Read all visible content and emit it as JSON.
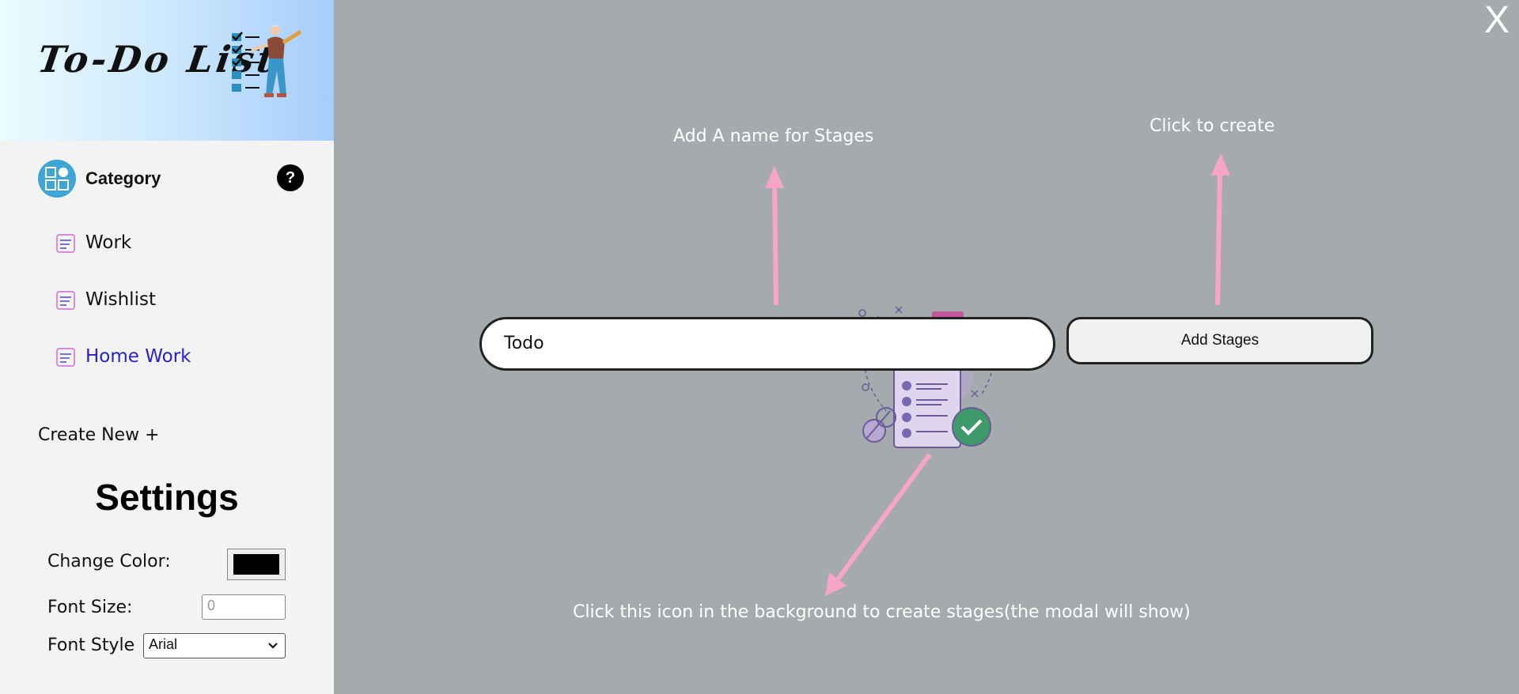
{
  "app": {
    "logo_text": "To-Do List"
  },
  "sidebar": {
    "category_label": "Category",
    "help_label": "?",
    "items": [
      {
        "label": "Work"
      },
      {
        "label": "Wishlist"
      },
      {
        "label": "Home Work"
      }
    ],
    "active_item": "Home Work",
    "create_new_label": "Create New +"
  },
  "settings": {
    "title": "Settings",
    "change_color_label": "Change Color:",
    "color_value": "#000000",
    "font_size_label": "Font Size:",
    "font_size_placeholder": "0",
    "font_style_label": "Font Style",
    "font_style_value": "Arial"
  },
  "modal": {
    "close_label": "X",
    "stage_input_value": "Todo",
    "add_stages_label": "Add Stages",
    "hint_name": "Add A name for Stages",
    "hint_create": "Click to create",
    "hint_icon": "Click this icon in the background to create stages(the modal will show)"
  },
  "colors": {
    "overlay": "#a5aaad",
    "arrow": "#f7a5c5",
    "active_link": "#2a1fc7",
    "category_icon": "#3fa5d3"
  }
}
